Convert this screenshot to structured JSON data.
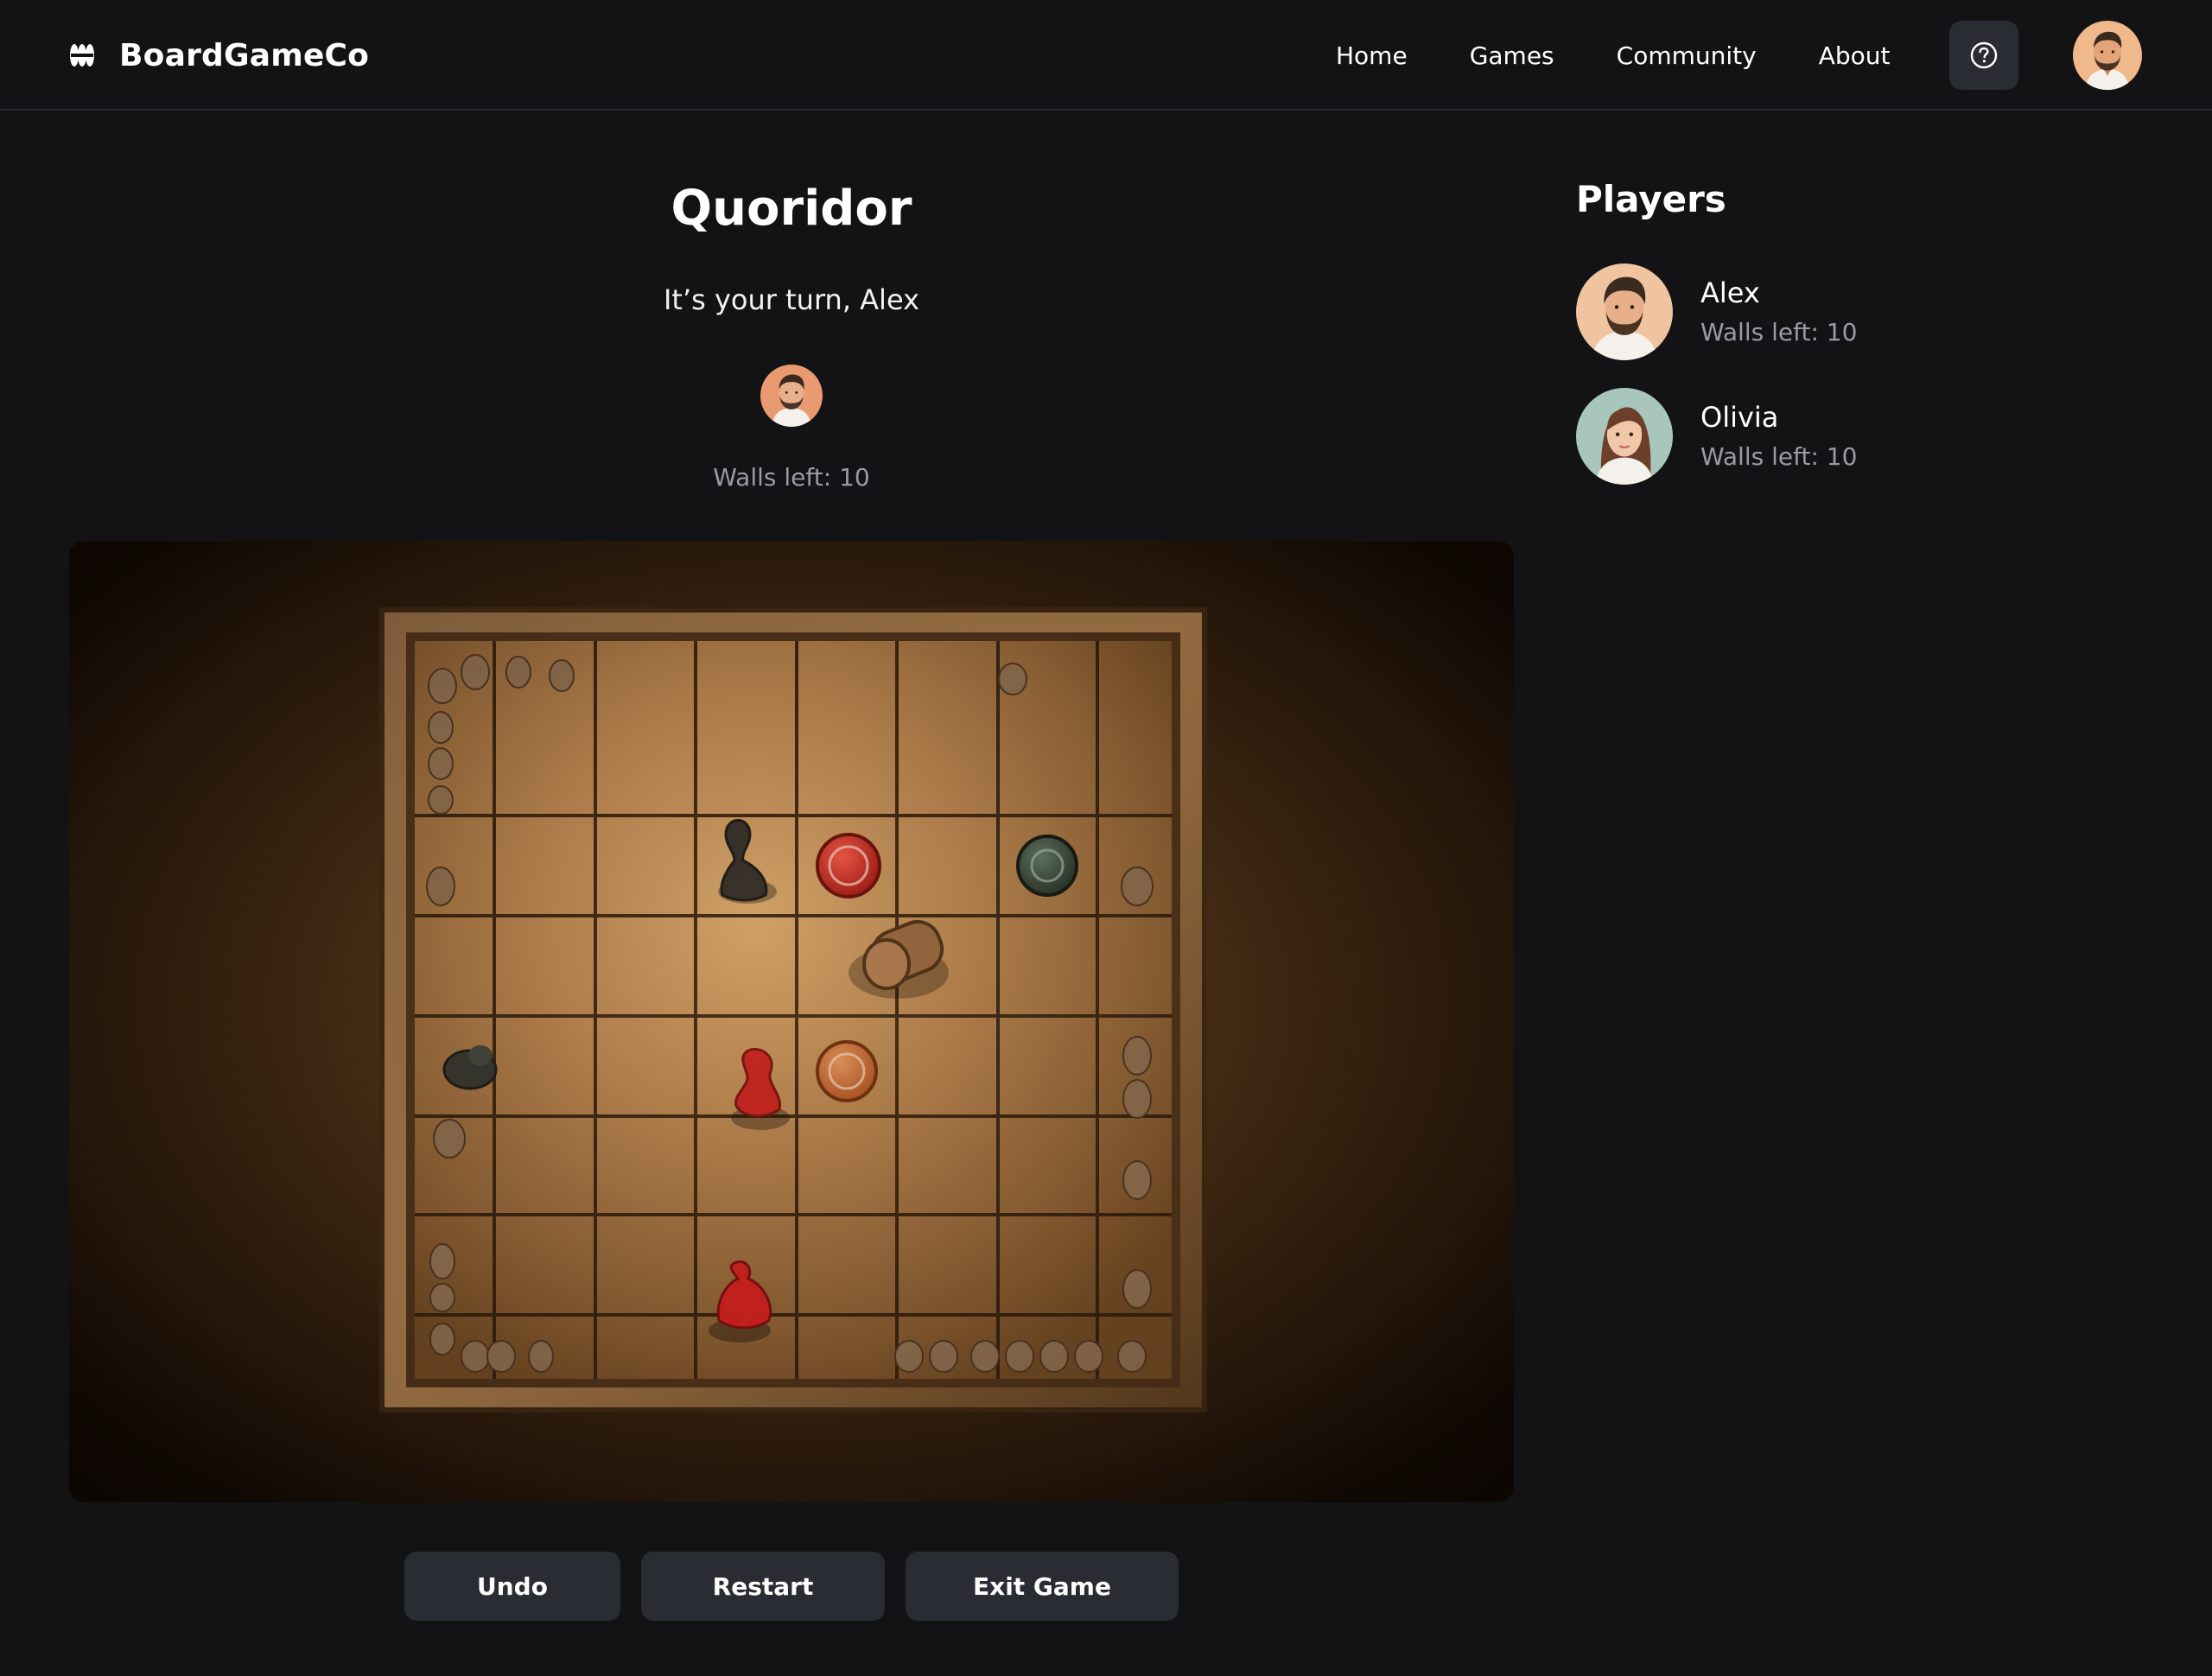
{
  "brand": {
    "name": "BoardGameCo",
    "logo_icon": "brand-logo-icon"
  },
  "nav": {
    "items": [
      {
        "label": "Home"
      },
      {
        "label": "Games"
      },
      {
        "label": "Community"
      },
      {
        "label": "About"
      }
    ],
    "help_icon": "question-circle-icon",
    "avatar_icon": "user-avatar"
  },
  "game": {
    "title": "Quoridor",
    "turn_text": "It’s your turn, Alex",
    "current_walls": "Walls left: 10"
  },
  "controls": {
    "undo": "Undo",
    "restart": "Restart",
    "exit": "Exit Game"
  },
  "sidebar": {
    "title": "Players",
    "players": [
      {
        "name": "Alex",
        "walls": "Walls left: 10"
      },
      {
        "name": "Olivia",
        "walls": "Walls left: 10"
      }
    ]
  },
  "colors": {
    "background": "#131316",
    "button_bg": "#2a2c33",
    "muted_text": "#9a9ba3",
    "board_wood": "#b88a55",
    "piece_red": "#d31f1f"
  }
}
